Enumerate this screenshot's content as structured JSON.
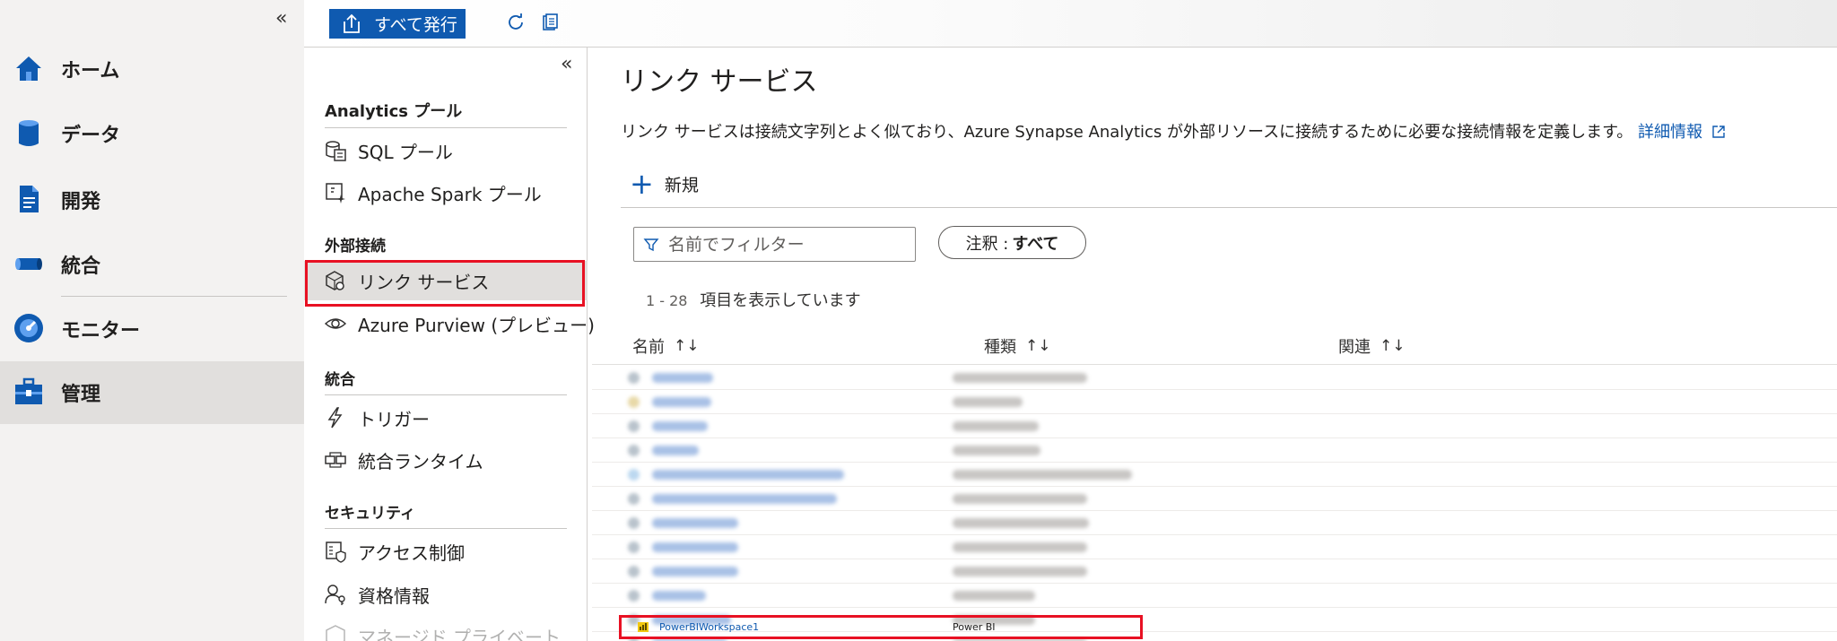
{
  "leftnav": {
    "collapse": "«",
    "items": [
      {
        "label": "ホーム",
        "icon": "home-icon"
      },
      {
        "label": "データ",
        "icon": "database-icon"
      },
      {
        "label": "開発",
        "icon": "document-icon"
      },
      {
        "label": "統合",
        "icon": "pipeline-icon"
      },
      {
        "label": "モニター",
        "icon": "gauge-icon"
      },
      {
        "label": "管理",
        "icon": "toolbox-icon"
      }
    ],
    "active": "管理"
  },
  "toolbar": {
    "publish_label": "すべて発行",
    "refresh_icon": "refresh-icon",
    "discard_icon": "discard-icon"
  },
  "midpanel": {
    "collapse": "«",
    "sections": [
      {
        "heading": "Analytics プール",
        "items": [
          {
            "label": "SQL プール",
            "icon": "sql-pool-icon"
          },
          {
            "label": "Apache Spark プール",
            "icon": "spark-pool-icon"
          }
        ]
      },
      {
        "heading": "外部接続",
        "items": [
          {
            "label": "リンク サービス",
            "icon": "linked-service-icon"
          },
          {
            "label": "Azure Purview (プレビュー)",
            "icon": "eye-icon"
          }
        ]
      },
      {
        "heading": "統合",
        "items": [
          {
            "label": "トリガー",
            "icon": "lightning-icon"
          },
          {
            "label": "統合ランタイム",
            "icon": "runtime-icon"
          }
        ]
      },
      {
        "heading": "セキュリティ",
        "items": [
          {
            "label": "アクセス制御",
            "icon": "access-control-icon"
          },
          {
            "label": "資格情報",
            "icon": "credentials-icon"
          },
          {
            "label": "マネージド プライベート",
            "icon": "private-endpoint-icon"
          }
        ]
      }
    ]
  },
  "main": {
    "title": "リンク サービス",
    "description": "リンク サービスは接続文字列とよく似ており、Azure Synapse Analytics が外部リソースに接続するために必要な接続情報を定義します。",
    "learn_more": "詳細情報",
    "new_label": "新規",
    "filter_placeholder": "名前でフィルター",
    "annotation_label": "注釈 :",
    "annotation_value": "すべて",
    "count_range": "1 - 28",
    "count_text": "項目を表示しています",
    "columns": [
      {
        "label": "名前",
        "sort": "↑↓"
      },
      {
        "label": "種類",
        "sort": "↑↓"
      },
      {
        "label": "関連",
        "sort": "↑↓"
      }
    ],
    "highlighted_row": {
      "name": "PowerBIWorkspace1",
      "type": "Power BI"
    }
  },
  "colors": {
    "accent": "#0f5ab0",
    "highlight": "#e81123",
    "nav_bg": "#f3f2f1",
    "active_bg": "#e1dfdd"
  }
}
